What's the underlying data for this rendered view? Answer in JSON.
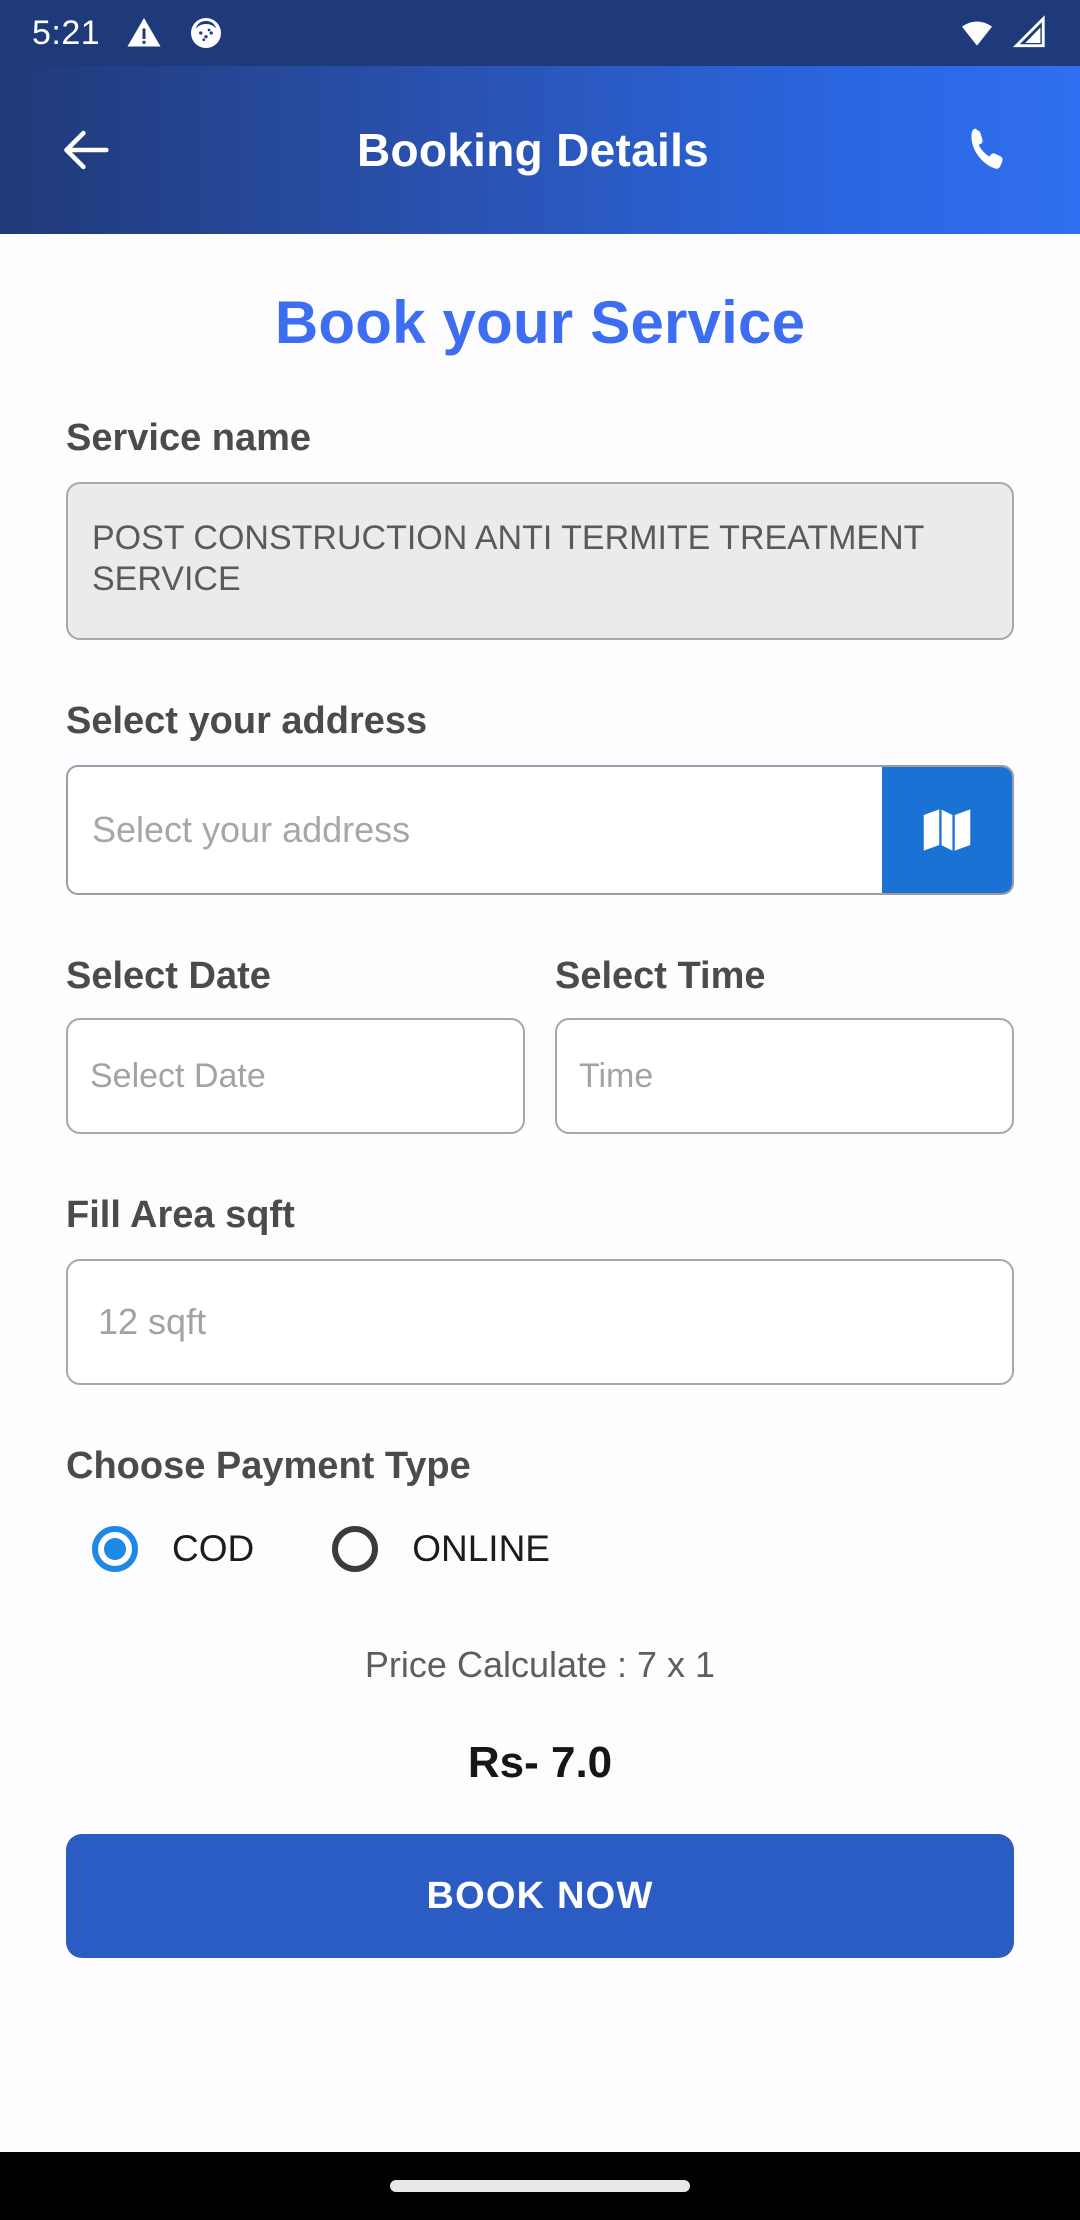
{
  "status_bar": {
    "time": "5:21",
    "icons_left": [
      "warning-triangle-icon",
      "debug-circle-icon"
    ],
    "icons_right": [
      "wifi-icon",
      "cell-signal-icon"
    ],
    "background": "#1f3a7a"
  },
  "app_bar": {
    "title": "Booking Details",
    "back_icon": "back-arrow-icon",
    "call_icon": "phone-icon",
    "gradient_from": "#203a78",
    "gradient_to": "#2f6ef0"
  },
  "page": {
    "heading": "Book your Service",
    "heading_color": "#3d6ef2"
  },
  "service": {
    "label": "Service name",
    "value": "POST CONSTRUCTION ANTI TERMITE TREATMENT SERVICE"
  },
  "address": {
    "label": "Select your address",
    "placeholder": "Select your address",
    "map_icon": "map-icon",
    "map_button_color": "#1a73d4"
  },
  "date": {
    "label": "Select Date",
    "placeholder": "Select Date"
  },
  "time": {
    "label": "Select Time",
    "placeholder": "Time"
  },
  "area": {
    "label": "Fill Area sqft",
    "placeholder": "12 sqft"
  },
  "payment": {
    "label": "Choose Payment Type",
    "options": [
      {
        "label": "COD",
        "selected": true
      },
      {
        "label": "ONLINE",
        "selected": false
      }
    ],
    "selected_color": "#1e88e5"
  },
  "price": {
    "calculation": "Price Calculate : 7 x 1",
    "total": "Rs- 7.0"
  },
  "actions": {
    "book_now": "BOOK NOW",
    "book_now_color": "#2b5cc4"
  },
  "nav_bar": {
    "home_indicator": "home-indicator"
  }
}
